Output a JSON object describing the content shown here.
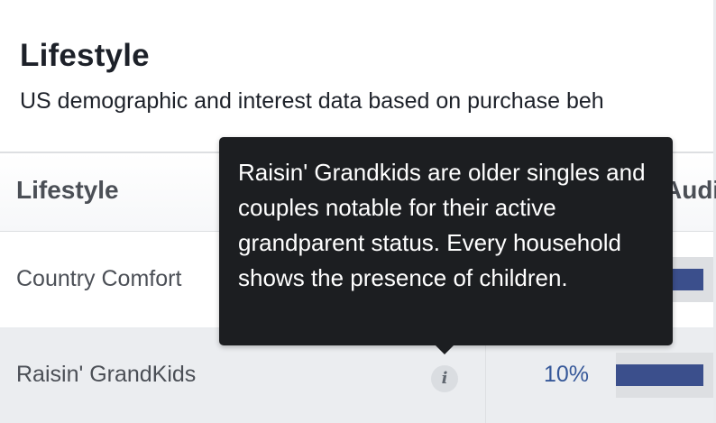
{
  "panel": {
    "title": "Lifestyle",
    "subtitle": "US demographic and interest data based on purchase beh"
  },
  "table": {
    "columns": [
      {
        "label": "Lifestyle"
      },
      {
        "label": "Audie"
      }
    ],
    "rows": [
      {
        "label": "Country Comfort",
        "percent_text": "",
        "bar_fill_fraction": 0.9
      },
      {
        "label": "Raisin' GrandKids",
        "percent_text": "10%",
        "bar_fill_fraction": 0.9,
        "info_icon": "info-icon"
      }
    ]
  },
  "tooltip": {
    "text": "Raisin' Grandkids are older singles and couples notable for their active grandparent status. Every household shows the presence of children."
  },
  "colors": {
    "bar_fill": "#3b4f8c",
    "bar_track": "#dddfe2",
    "percent_text": "#365899",
    "tooltip_background": "#1c1e21",
    "highlight_row": "#ebedf0"
  }
}
